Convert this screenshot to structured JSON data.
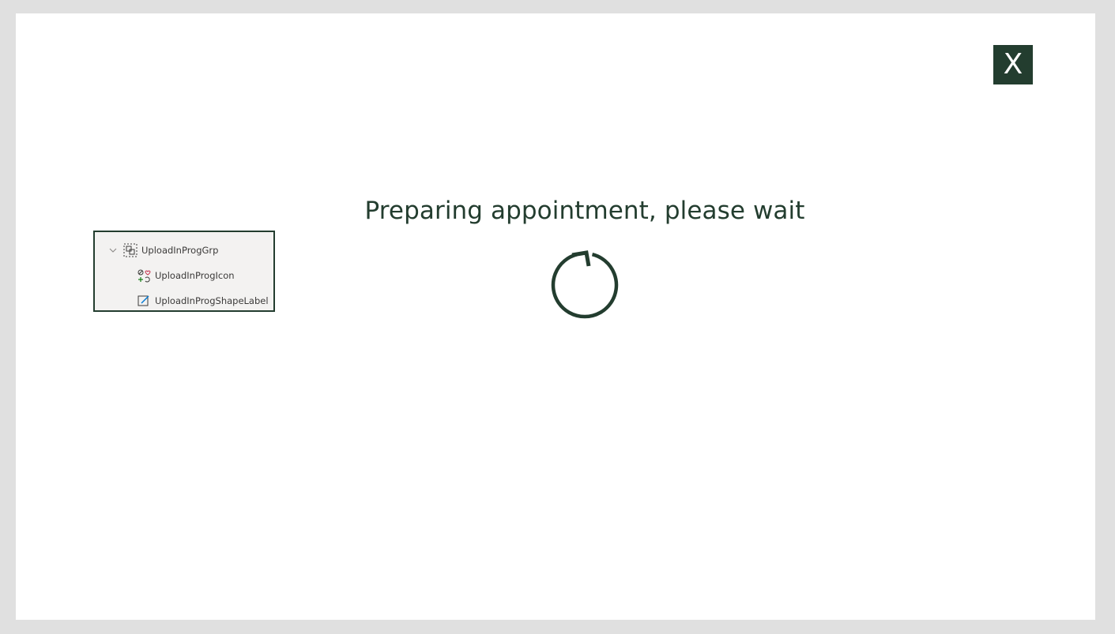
{
  "window": {
    "close_label": "X"
  },
  "loading": {
    "message": "Preparing appointment, please wait"
  },
  "tree": {
    "items": [
      {
        "label": "UploadInProgGrp",
        "icon": "group-icon",
        "expanded": true
      },
      {
        "label": "UploadInProgIcon",
        "icon": "icons-icon"
      },
      {
        "label": "UploadInProgShapeLabel",
        "icon": "edit-label-icon"
      }
    ]
  },
  "colors": {
    "accent": "#233d2f",
    "background": "#ffffff",
    "frame": "#e0e0e0",
    "panel": "#f3f2f1"
  }
}
